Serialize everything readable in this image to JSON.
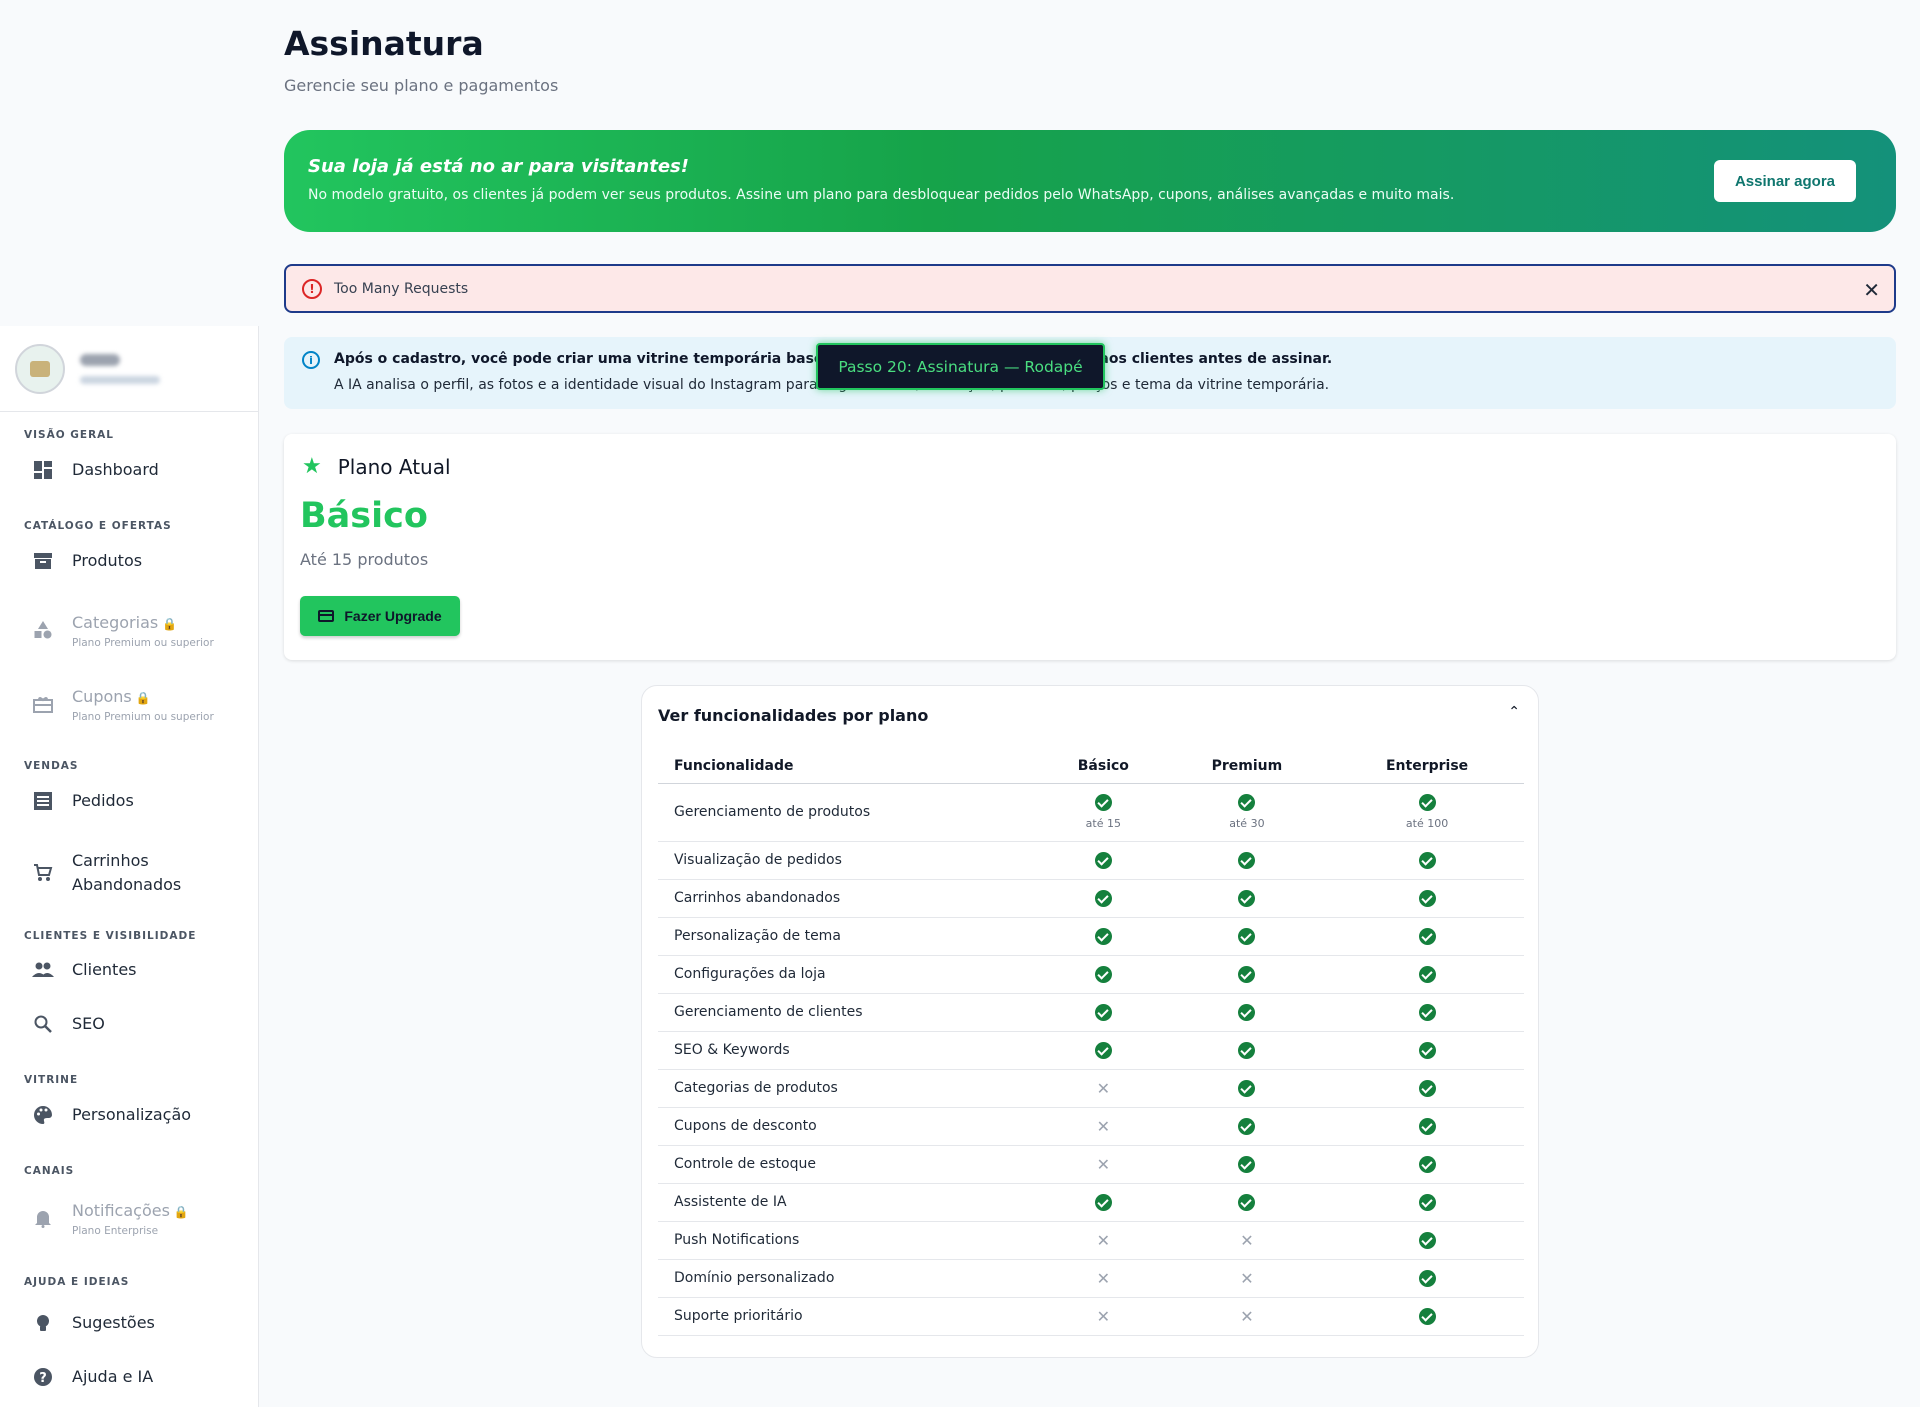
{
  "page": {
    "title": "Assinatura",
    "subtitle": "Gerencie seu plano e pagamentos"
  },
  "banner": {
    "title": "Sua loja já está no ar para visitantes!",
    "text": "No modelo gratuito, os clientes já podem ver seus produtos. Assine um plano para desbloquear pedidos pelo WhatsApp, cupons, análises avançadas e muito mais.",
    "button": "Assinar agora"
  },
  "error_alert": {
    "text": "Too Many Requests",
    "close": "✕"
  },
  "info_alert": {
    "title": "Após o cadastro, você pode criar uma vitrine temporária baseada no Instagram para apresentar aos clientes antes de assinar.",
    "text": "A IA analisa o perfil, as fotos e a identidade visual do Instagram para sugerir nome, descrição, produtos, preços e tema da vitrine temporária."
  },
  "tooltip": {
    "text": "Passo 20: Assinatura — Rodapé"
  },
  "current_plan": {
    "heading": "Plano Atual",
    "name": "Básico",
    "limit": "Até 15 produtos",
    "upgrade_button": "Fazer Upgrade"
  },
  "sidebar": {
    "sections": [
      {
        "label": "VISÃO GERAL"
      },
      {
        "label": "CATÁLOGO E OFERTAS"
      },
      {
        "label": "VENDAS"
      },
      {
        "label": "CLIENTES E VISIBILIDADE"
      },
      {
        "label": "VITRINE"
      },
      {
        "label": "CANAIS"
      },
      {
        "label": "AJUDA E IDEIAS"
      }
    ],
    "items": [
      {
        "label": "Dashboard",
        "icon": "dashboard-icon"
      },
      {
        "label": "Produtos",
        "icon": "archive-icon"
      },
      {
        "label": "Categorias",
        "sub": "Plano Premium ou superior",
        "icon": "category-icon",
        "locked": true
      },
      {
        "label": "Cupons",
        "sub": "Plano Premium ou superior",
        "icon": "coupon-icon",
        "locked": true
      },
      {
        "label": "Pedidos",
        "icon": "list-icon"
      },
      {
        "label": "Carrinhos Abandonados",
        "icon": "cart-icon"
      },
      {
        "label": "Clientes",
        "icon": "people-icon"
      },
      {
        "label": "SEO",
        "icon": "search-icon"
      },
      {
        "label": "Personalização",
        "icon": "palette-icon"
      },
      {
        "label": "Notificações",
        "sub": "Plano Enterprise",
        "icon": "bell-icon",
        "locked": true
      },
      {
        "label": "Sugestões",
        "icon": "lightbulb-icon"
      },
      {
        "label": "Ajuda e IA",
        "icon": "help-icon"
      }
    ]
  },
  "features": {
    "title": "Ver funcionalidades por plano",
    "headers": [
      "Funcionalidade",
      "Básico",
      "Premium",
      "Enterprise"
    ],
    "rows": [
      {
        "name": "Gerenciamento de produtos",
        "basico": true,
        "premium": true,
        "enterprise": true,
        "limits": [
          "até 15",
          "até 30",
          "até 100"
        ]
      },
      {
        "name": "Visualização de pedidos",
        "basico": true,
        "premium": true,
        "enterprise": true
      },
      {
        "name": "Carrinhos abandonados",
        "basico": true,
        "premium": true,
        "enterprise": true
      },
      {
        "name": "Personalização de tema",
        "basico": true,
        "premium": true,
        "enterprise": true
      },
      {
        "name": "Configurações da loja",
        "basico": true,
        "premium": true,
        "enterprise": true
      },
      {
        "name": "Gerenciamento de clientes",
        "basico": true,
        "premium": true,
        "enterprise": true
      },
      {
        "name": "SEO & Keywords",
        "basico": true,
        "premium": true,
        "enterprise": true
      },
      {
        "name": "Categorias de produtos",
        "basico": false,
        "premium": true,
        "enterprise": true
      },
      {
        "name": "Cupons de desconto",
        "basico": false,
        "premium": true,
        "enterprise": true
      },
      {
        "name": "Controle de estoque",
        "basico": false,
        "premium": true,
        "enterprise": true
      },
      {
        "name": "Assistente de IA",
        "basico": true,
        "premium": true,
        "enterprise": true
      },
      {
        "name": "Push Notifications",
        "basico": false,
        "premium": false,
        "enterprise": true
      },
      {
        "name": "Domínio personalizado",
        "basico": false,
        "premium": false,
        "enterprise": true
      },
      {
        "name": "Suporte prioritário",
        "basico": false,
        "premium": false,
        "enterprise": true
      }
    ]
  },
  "colors": {
    "accent": "#22c55e",
    "check": "#15803d",
    "lock": "#f59e0b"
  }
}
